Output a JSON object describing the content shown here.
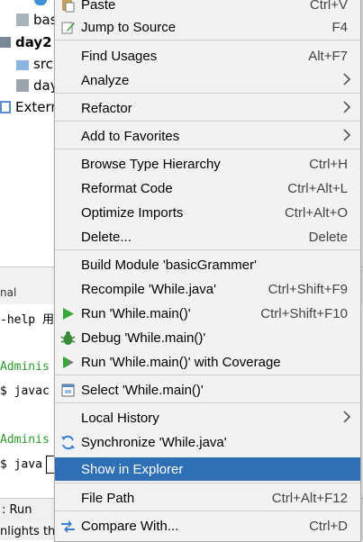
{
  "project_tree": {
    "items": [
      {
        "label": "bas",
        "kind": "module-file"
      },
      {
        "label": "day2",
        "kind": "module"
      },
      {
        "label": "src",
        "kind": "folder"
      },
      {
        "label": "day",
        "kind": "file"
      },
      {
        "label": "Extern",
        "kind": "library"
      }
    ]
  },
  "terminal": {
    "tab_label": "nal",
    "lines": [
      "-help 用",
      "Adminis",
      "$ javac",
      "Adminis",
      "$ java"
    ]
  },
  "bottom_bar": {
    "run_label": ": Run"
  },
  "status_bar": {
    "text": "nlights th"
  },
  "context_menu": {
    "items": [
      {
        "label": "Paste",
        "shortcut": "Ctrl+V",
        "icon": "paste-icon"
      },
      {
        "label": "Jump to Source",
        "shortcut": "F4",
        "icon": "jump-to-source-icon"
      },
      {
        "label": "Find Usages",
        "shortcut": "Alt+F7"
      },
      {
        "label": "Analyze",
        "submenu": true
      },
      {
        "label": "Refactor",
        "submenu": true
      },
      {
        "label": "Add to Favorites",
        "submenu": true
      },
      {
        "label": "Browse Type Hierarchy",
        "shortcut": "Ctrl+H"
      },
      {
        "label": "Reformat Code",
        "shortcut": "Ctrl+Alt+L"
      },
      {
        "label": "Optimize Imports",
        "shortcut": "Ctrl+Alt+O"
      },
      {
        "label": "Delete...",
        "shortcut": "Delete"
      },
      {
        "label": "Build Module 'basicGrammer'"
      },
      {
        "label": "Recompile 'While.java'",
        "shortcut": "Ctrl+Shift+F9"
      },
      {
        "label": "Run 'While.main()'",
        "shortcut": "Ctrl+Shift+F10",
        "icon": "run-icon"
      },
      {
        "label": "Debug 'While.main()'",
        "icon": "debug-icon"
      },
      {
        "label": "Run 'While.main()' with Coverage",
        "icon": "coverage-icon"
      },
      {
        "label": "Select 'While.main()'",
        "icon": "select-in-icon"
      },
      {
        "label": "Local History",
        "submenu": true
      },
      {
        "label": "Synchronize 'While.java'",
        "icon": "synchronize-icon"
      },
      {
        "label": "Show in Explorer",
        "highlighted": true
      },
      {
        "label": "File Path",
        "shortcut": "Ctrl+Alt+F12"
      },
      {
        "label": "Compare With...",
        "shortcut": "Ctrl+D",
        "icon": "compare-icon"
      }
    ]
  },
  "colors": {
    "highlight": "#2f6fb5",
    "menu_background": "#f2f2f2",
    "terminal_prompt_green": "#2d9a2d"
  }
}
